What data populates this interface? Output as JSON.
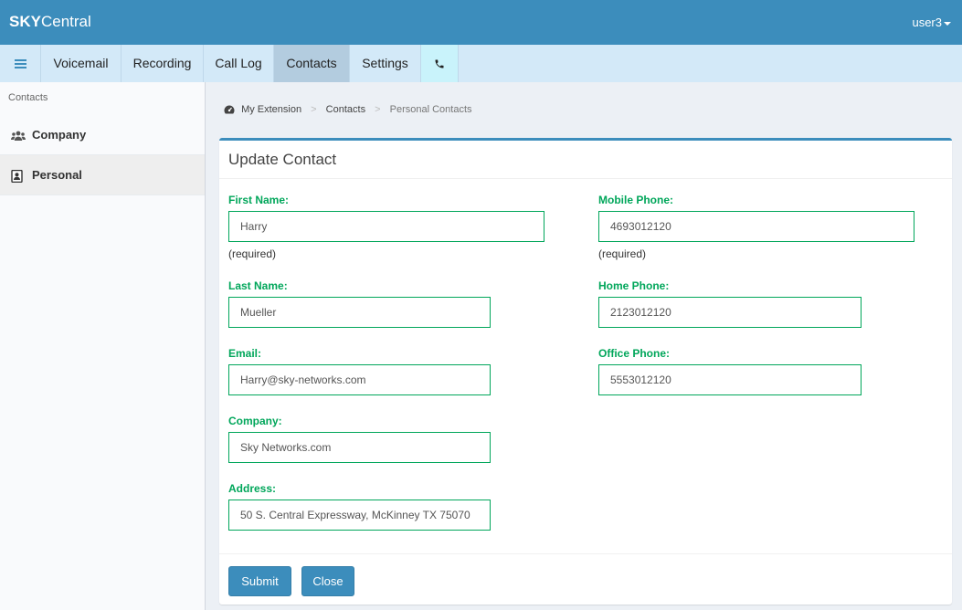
{
  "header": {
    "brand_bold": "SKY",
    "brand_rest": "Central",
    "user": "user3"
  },
  "nav": {
    "tabs": [
      {
        "label": "Voicemail"
      },
      {
        "label": "Recording"
      },
      {
        "label": "Call Log"
      },
      {
        "label": "Contacts"
      },
      {
        "label": "Settings"
      }
    ],
    "active_tab": "Contacts"
  },
  "sidebar": {
    "header": "Contacts",
    "items": [
      {
        "label": "Company",
        "icon": "users-icon"
      },
      {
        "label": "Personal",
        "icon": "address-book-icon"
      }
    ],
    "active_item": "Personal"
  },
  "breadcrumb": {
    "home": "My Extension",
    "section": "Contacts",
    "current": "Personal Contacts"
  },
  "form": {
    "title": "Update Contact",
    "fields": {
      "first_name": {
        "label": "First Name:",
        "value": "Harry",
        "hint": "(required)"
      },
      "last_name": {
        "label": "Last Name:",
        "value": "Mueller"
      },
      "email": {
        "label": "Email:",
        "value": "Harry@sky-networks.com"
      },
      "company": {
        "label": "Company:",
        "value": "Sky Networks.com"
      },
      "address": {
        "label": "Address:",
        "value": "50 S. Central Expressway, McKinney TX 75070"
      },
      "mobile_phone": {
        "label": "Mobile Phone:",
        "value": "4693012120",
        "hint": "(required)"
      },
      "home_phone": {
        "label": "Home Phone:",
        "value": "2123012120"
      },
      "office_phone": {
        "label": "Office Phone:",
        "value": "5553012120"
      }
    },
    "submit_label": "Submit",
    "close_label": "Close"
  },
  "colors": {
    "header": "#3c8dbc",
    "nav": "#d3e9f8",
    "field_accent": "#00a65a"
  }
}
